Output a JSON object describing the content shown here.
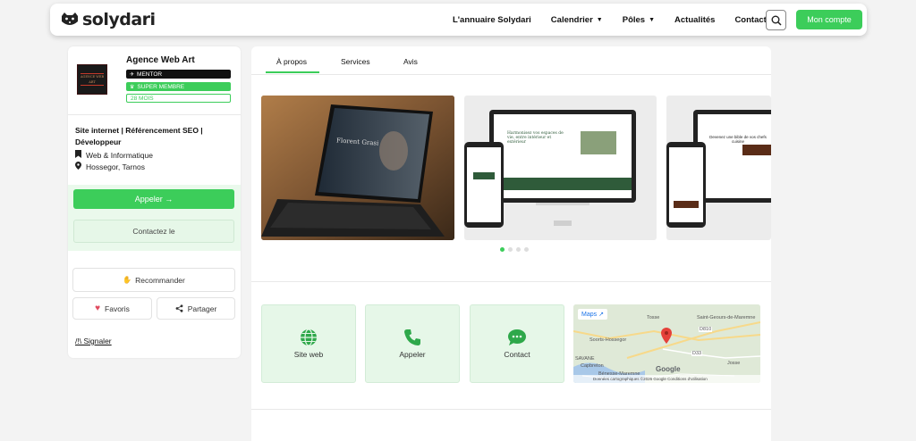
{
  "header": {
    "logo_text": "solydari",
    "nav": [
      {
        "label": "L'annuaire Solydari",
        "chevron": false
      },
      {
        "label": "Calendrier",
        "chevron": true
      },
      {
        "label": "Pôles",
        "chevron": true
      },
      {
        "label": "Actualités",
        "chevron": false
      },
      {
        "label": "Contact",
        "chevron": false
      }
    ],
    "account_label": "Mon compte",
    "accent": "#3ccd5a"
  },
  "profile": {
    "name": "Agence Web Art",
    "avatar_text": "AGENCE WEB ART",
    "badges": {
      "mentor": "MENTOR",
      "super": "SUPER MEMBRE",
      "months": "28 MOIS"
    },
    "description": "Site internet | Référencement SEO | Développeur",
    "category": "Web & Informatique",
    "location": "Hossegor, Tarnos",
    "call_label": "Appeler →",
    "contact_label": "Contactez le",
    "recommend_label": "Recommander",
    "favorite_label": "Favoris",
    "share_label": "Partager",
    "report_label": "/!\\ Signaler"
  },
  "main": {
    "tabs": [
      "À propos",
      "Services",
      "Avis"
    ],
    "active_tab": 0,
    "slides": {
      "slide1_text": "Florent Grasi",
      "slide2_heading": "Harmonisez vos espaces de vie, entre intérieur et extérieur",
      "slide3_heading": "Devenez une bible de vos chefs cuisine"
    },
    "carousel_dots": 4,
    "carousel_active": 0,
    "actions": [
      {
        "label": "Site web",
        "icon": "globe-icon"
      },
      {
        "label": "Appeler",
        "icon": "phone-icon"
      },
      {
        "label": "Contact",
        "icon": "chat-icon"
      }
    ],
    "map": {
      "maps_label": "Maps",
      "places": {
        "tosse": "Tosse",
        "saint_geours": "Saint-Geours-de-Maremne",
        "soorts": "Soorts-Hossegor",
        "capbreton": "Capbreton",
        "benesse": "Bénesse-Maremne",
        "savane": "SAVANE",
        "josse": "Josse",
        "d33": "D33",
        "d810": "D810"
      },
      "google": "Google",
      "credit": "Données cartographiques ©2026 Google     Conditions d'utilisation"
    }
  }
}
